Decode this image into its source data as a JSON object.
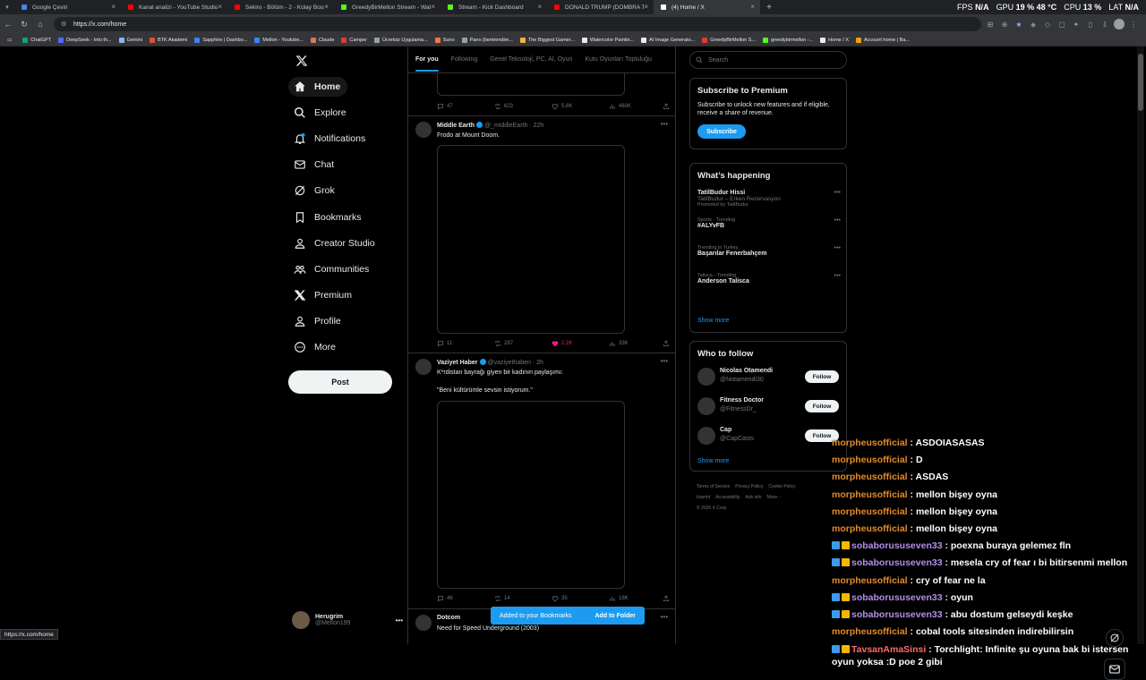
{
  "browser": {
    "tabs": [
      {
        "title": "Google Çeviri",
        "color": "#4285f4"
      },
      {
        "title": "Kanal analizi - YouTube Studio",
        "color": "#ff0000"
      },
      {
        "title": "Sekiro - Bölüm - 2 - Kolay Boss ?!?",
        "color": "#ff0000"
      },
      {
        "title": "GreedyBirMellon Stream - Watch Li",
        "color": "#53fc18"
      },
      {
        "title": "Stream - Kick Dashboard",
        "color": "#53fc18"
      },
      {
        "title": "DONALD TRUMP (DOMBRA TRAP",
        "color": "#ff0000"
      },
      {
        "title": "(4) Home / X",
        "color": "#ffffff",
        "active": true
      }
    ],
    "url": "https://x.com/home",
    "stats": {
      "fps_label": "FPS",
      "fps": "N/A",
      "gpu_label": "GPU",
      "gpu": "19 %",
      "gpu_temp": "48 °C",
      "cpu_label": "CPU",
      "cpu": "13 %",
      "lat_label": "LAT",
      "lat": "N/A"
    },
    "bookmarks": [
      {
        "label": "ChatGPT",
        "color": "#10a37f"
      },
      {
        "label": "DeepSeek - Into th...",
        "color": "#4d6bfe"
      },
      {
        "label": "Gemini",
        "color": "#8ab4f8"
      },
      {
        "label": "BTK Akademi",
        "color": "#e74c3c"
      },
      {
        "label": "Sapphire | Dashbo...",
        "color": "#3b82f6"
      },
      {
        "label": "Mellon - Youtube...",
        "color": "#3b82f6"
      },
      {
        "label": "Claude",
        "color": "#d97757"
      },
      {
        "label": "Camper",
        "color": "#e53935"
      },
      {
        "label": "Ücretsiz Uygulama...",
        "color": "#9aa0a6"
      },
      {
        "label": "Suno",
        "color": "#ff7043"
      },
      {
        "label": "Pano (bentrendim...",
        "color": "#9aa0a6"
      },
      {
        "label": "The Biggest Gamer...",
        "color": "#f5b041"
      },
      {
        "label": "Watercolor Paintin...",
        "color": "#e8eaed"
      },
      {
        "label": "AI Image Generato...",
        "color": "#e8eaed"
      },
      {
        "label": "GreedyBirMellon S...",
        "color": "#e53935"
      },
      {
        "label": "greedybirmellon -...",
        "color": "#53fc18"
      },
      {
        "label": "Home / X",
        "color": "#e8eaed"
      },
      {
        "label": "Account home | Ba...",
        "color": "#f39c12"
      }
    ],
    "status_url": "https://x.com/home"
  },
  "nav": {
    "items": [
      {
        "label": "Home",
        "icon": "home-icon"
      },
      {
        "label": "Explore",
        "icon": "search-icon"
      },
      {
        "label": "Notifications",
        "icon": "bell-icon"
      },
      {
        "label": "Chat",
        "icon": "mail-icon"
      },
      {
        "label": "Grok",
        "icon": "grok-icon"
      },
      {
        "label": "Bookmarks",
        "icon": "bookmark-icon"
      },
      {
        "label": "Creator Studio",
        "icon": "person-icon"
      },
      {
        "label": "Communities",
        "icon": "people-icon"
      },
      {
        "label": "Premium",
        "icon": "x-icon"
      },
      {
        "label": "Profile",
        "icon": "person-icon"
      },
      {
        "label": "More",
        "icon": "more-circle-icon"
      }
    ],
    "post_label": "Post",
    "account": {
      "name": "Herugrim",
      "handle": "@Mellon199"
    }
  },
  "feed": {
    "tabs": [
      "For you",
      "Following",
      "Genel Teknoloji, PC, AI, Oyun",
      "Kutu Oyunları Topluluğu"
    ],
    "top_actions": {
      "replies": "47",
      "reposts": "623",
      "likes": "5.8K",
      "views": "460K"
    },
    "tweets": [
      {
        "name": "Middle Earth",
        "handle": "@_middleEarth",
        "time": "22h",
        "text": "Frodo at Mount Doom.",
        "actions": {
          "replies": "11",
          "reposts": "287",
          "likes": "2.2K",
          "views": "33K"
        }
      },
      {
        "name": "Vaziyet Haber",
        "handle": "@vaziyethaberi",
        "time": "2h",
        "text": "K*rdistan bayrağı giyen bir kadının paylaşımı:\n\n\"Beni kültürümle sevsin istiyorum.\"",
        "actions": {
          "replies": "46",
          "reposts": "14",
          "likes": "35",
          "views": "18K"
        }
      },
      {
        "name": "Dotcom",
        "handle": "",
        "time": "",
        "text": "Need for Speed Underground (2003)"
      }
    ],
    "toast": {
      "message": "Added to your Bookmarks",
      "action": "Add to Folder"
    }
  },
  "sidebar": {
    "search_placeholder": "Search",
    "premium": {
      "title": "Subscribe to Premium",
      "body": "Subscribe to unlock new features and if eligible, receive a share of revenue.",
      "button": "Subscribe"
    },
    "happening": {
      "title": "What’s happening",
      "trends": [
        {
          "context": "",
          "title": "TatilBudur Hissi",
          "sub": "TatilBudur – Erken Rezervasyon",
          "promo": "Promoted by TatilBudur"
        },
        {
          "context": "Sports · Trending",
          "title": "#ALYvFB",
          "sub": "",
          "promo": ""
        },
        {
          "context": "Trending in Turkey",
          "title": "Başarılar Fenerbahçem",
          "sub": "",
          "promo": ""
        },
        {
          "context": "Talisca · Trending",
          "title": "Anderson Talisca",
          "sub": "",
          "promo": ""
        }
      ],
      "show_more": "Show more"
    },
    "who_to_follow": {
      "title": "Who to follow",
      "accounts": [
        {
          "name": "Nicolas Otamendi",
          "handle": "@Notamendi30",
          "button": "Follow"
        },
        {
          "name": "Fitness Doctor",
          "handle": "@FitnessDr_",
          "button": "Follow"
        },
        {
          "name": "Cap",
          "handle": "@CapCasts",
          "button": "Follow"
        }
      ],
      "show_more": "Show more"
    },
    "footer": [
      "Terms of Service",
      "Privacy Policy",
      "Cookie Policy",
      "Imprint",
      "Accessibility",
      "Ads info",
      "More···",
      "© 2026 X Corp."
    ]
  },
  "chat": [
    {
      "user": "morpheusofficial",
      "msg": " : ASDOIASASAS",
      "style": "u",
      "badge": false
    },
    {
      "user": "morpheusofficial",
      "msg": " : D",
      "style": "u",
      "badge": false
    },
    {
      "user": "morpheusofficial",
      "msg": " : ASDAS",
      "style": "u",
      "badge": false
    },
    {
      "user": "morpheusofficial",
      "msg": " : mellon bişey oyna",
      "style": "u",
      "badge": false
    },
    {
      "user": "morpheusofficial",
      "msg": " : mellon bişey oyna",
      "style": "u",
      "badge": false
    },
    {
      "user": "morpheusofficial",
      "msg": " : mellon bişey oyna",
      "style": "u",
      "badge": false
    },
    {
      "user": "sobaborususeven33",
      "msg": " : poexna buraya gelemez fln",
      "style": "u2",
      "badge": true
    },
    {
      "user": "sobaborususeven33",
      "msg": " : mesela cry of fear ı bi bitirsenmi mellon",
      "style": "u2",
      "badge": true
    },
    {
      "user": "morpheusofficial",
      "msg": " : cry of fear ne la",
      "style": "u",
      "badge": false
    },
    {
      "user": "sobaborususeven33",
      "msg": " : oyun",
      "style": "u2",
      "badge": true
    },
    {
      "user": "sobaborususeven33",
      "msg": " : abu dostum gelseydi keşke",
      "style": "u2",
      "badge": true
    },
    {
      "user": "morpheusofficial",
      "msg": " : cobal tools sitesinden indirebilirsin",
      "style": "u",
      "badge": false
    },
    {
      "user": "TavsanAmaSinsi",
      "msg": " : Torchlight: Infinite şu oyuna bak bi istersen oyun yoksa :D poe 2 gibi",
      "style": "u3",
      "badge": true
    }
  ],
  "colors": {
    "accent": "#1d9bf0",
    "like": "#f91880",
    "chat_user": "#e58a27",
    "chat_user2": "#b68ee8"
  }
}
